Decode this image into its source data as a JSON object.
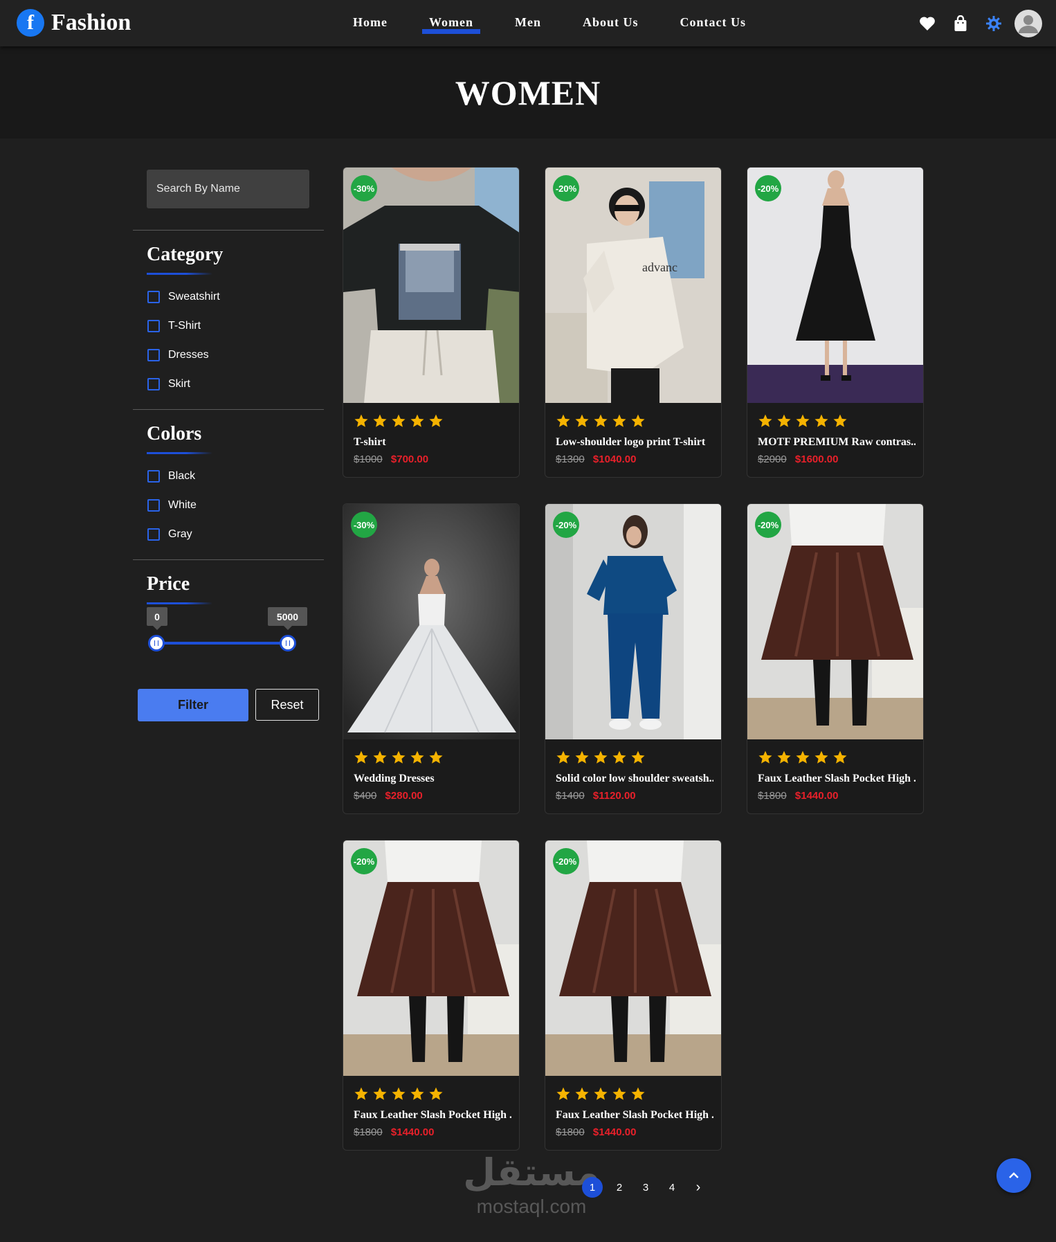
{
  "brand": {
    "logo_letter": "f",
    "name": "Fashion"
  },
  "nav": {
    "items": [
      "Home",
      "Women",
      "Men",
      "About Us",
      "Contact Us"
    ],
    "active": "Women",
    "icons": [
      "heart-icon",
      "shopping-bag-icon",
      "theme-gear-icon",
      "user-avatar"
    ]
  },
  "hero": {
    "title": "WOMEN"
  },
  "search": {
    "placeholder": "Search By Name",
    "value": ""
  },
  "filters": {
    "category": {
      "title": "Category",
      "options": [
        "Sweatshirt",
        "T-Shirt",
        "Dresses",
        "Skirt"
      ]
    },
    "colors": {
      "title": "Colors",
      "options": [
        "Black",
        "White",
        "Gray"
      ]
    },
    "price": {
      "title": "Price",
      "min_label": "0",
      "max_label": "5000",
      "min": 0,
      "max": 5000,
      "value_low": 0,
      "value_high": 5000
    },
    "filter_label": "Filter",
    "reset_label": "Reset"
  },
  "products": [
    {
      "name": "T-shirt",
      "discount": "-30%",
      "old_price": "$1000",
      "new_price": "$700.00",
      "rating": 5
    },
    {
      "name": "Low-shoulder logo print T-shirt",
      "discount": "-20%",
      "old_price": "$1300",
      "new_price": "$1040.00",
      "rating": 5
    },
    {
      "name": "MOTF PREMIUM Raw contras...",
      "discount": "-20%",
      "old_price": "$2000",
      "new_price": "$1600.00",
      "rating": 5
    },
    {
      "name": "Wedding Dresses",
      "discount": "-30%",
      "old_price": "$400",
      "new_price": "$280.00",
      "rating": 5
    },
    {
      "name": "Solid color low shoulder sweatsh...",
      "discount": "-20%",
      "old_price": "$1400",
      "new_price": "$1120.00",
      "rating": 5
    },
    {
      "name": "Faux Leather Slash Pocket High ...",
      "discount": "-20%",
      "old_price": "$1800",
      "new_price": "$1440.00",
      "rating": 5
    },
    {
      "name": "Faux Leather Slash Pocket High ...",
      "discount": "-20%",
      "old_price": "$1800",
      "new_price": "$1440.00",
      "rating": 5
    },
    {
      "name": "Faux Leather Slash Pocket High ...",
      "discount": "-20%",
      "old_price": "$1800",
      "new_price": "$1440.00",
      "rating": 5
    }
  ],
  "pagination": {
    "pages": [
      "1",
      "2",
      "3",
      "4"
    ],
    "current": "1",
    "next": "›"
  },
  "watermark": {
    "arabic": "مستقل",
    "latin": "mostaql.com"
  },
  "colors": {
    "accent": "#1d4fd8",
    "button": "#4a7cf0",
    "badge": "#22a644",
    "price": "#e8202a",
    "star": "#f5b301"
  }
}
